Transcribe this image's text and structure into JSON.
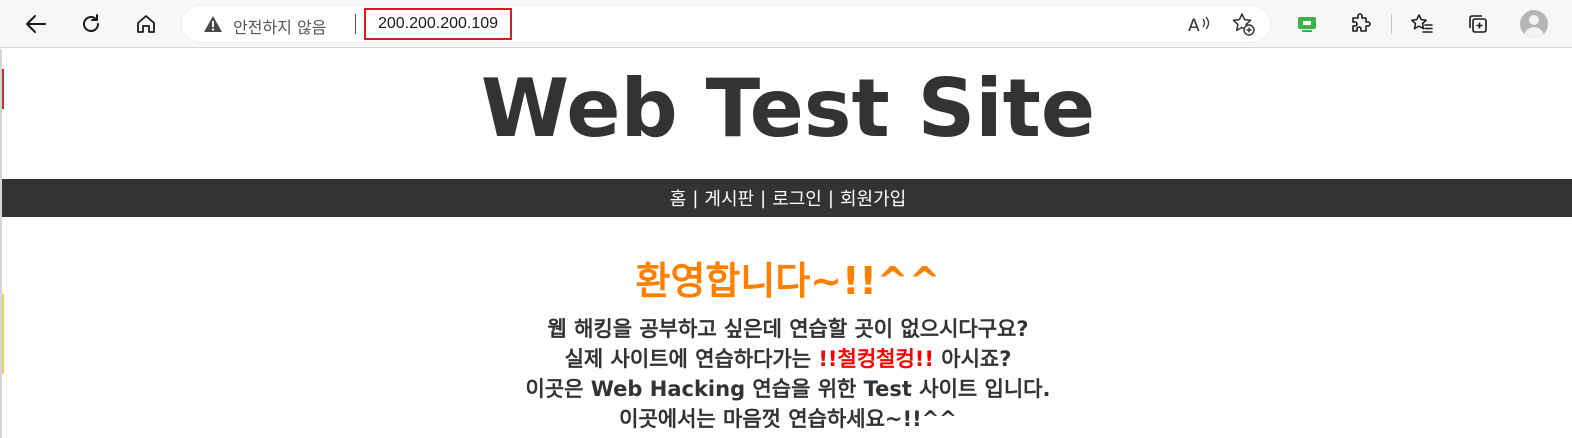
{
  "browser": {
    "address_bar": {
      "insecure_label": "안전하지 않음",
      "url": "200.200.200.109"
    },
    "icons": {
      "back": "back-arrow-icon",
      "refresh": "refresh-icon",
      "home": "home-icon",
      "warning": "warning-icon",
      "read_aloud": "read-aloud-icon",
      "favorite": "add-favorite-icon",
      "screen_cast": "screen-cast-icon",
      "extensions": "extensions-icon",
      "favorites": "favorites-icon",
      "collections": "collections-icon",
      "profile": "profile-avatar-icon"
    }
  },
  "site": {
    "title": "Web Test Site",
    "nav": {
      "home": "홈",
      "board": "게시판",
      "login": "로그인",
      "signup": "회원가입",
      "separator": "|"
    },
    "welcome": "환영합니다~!!^^",
    "intro": {
      "line1": "웹 해킹을 공부하고 싶은데 연습할 곳이 없으시다구요?",
      "line2_before": "실제 사이트에 연습하다가는 ",
      "line2_highlight": "!!철컹철컹!!",
      "line2_after": " 아시죠?",
      "line3": "이곳은 Web Hacking 연습을 위한 Test 사이트 입니다.",
      "line4": "이곳에서는 마음껏 연습하세요~!!^^"
    }
  },
  "colors": {
    "nav_background": "#333333",
    "title_text": "#333333",
    "welcome_text": "#ff8000",
    "highlight_text": "#ff0000",
    "url_outline": "#e1171e"
  }
}
